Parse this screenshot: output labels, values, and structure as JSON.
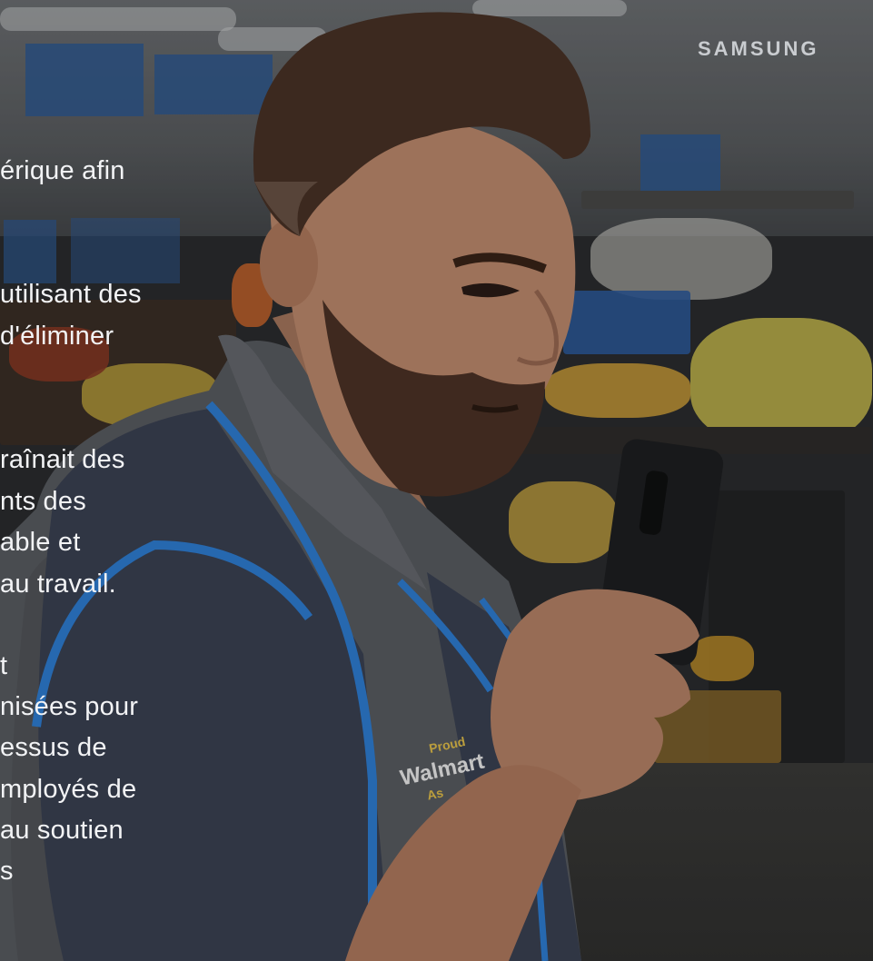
{
  "brand": {
    "logo_text": "SAMSUNG"
  },
  "overlay_text": {
    "lines": [
      "érique afin",
      "utilisant des",
      "d'éliminer",
      "raînait des",
      "nts des",
      "able et",
      "au travail.",
      "t",
      "nisées pour",
      "essus de",
      "mployés de",
      "au soutien",
      "s"
    ]
  },
  "vest": {
    "line1": "Proud",
    "line2": "Walmart",
    "line3": "As"
  },
  "colors": {
    "text": "#f2f3f5",
    "brand": "#c9ccd0",
    "vest": "#3b4254",
    "vest_trim": "#2f7fd6",
    "shirt": "#5a5d62",
    "phone": "#1e1f21",
    "vest_text": "#e4c14b"
  }
}
